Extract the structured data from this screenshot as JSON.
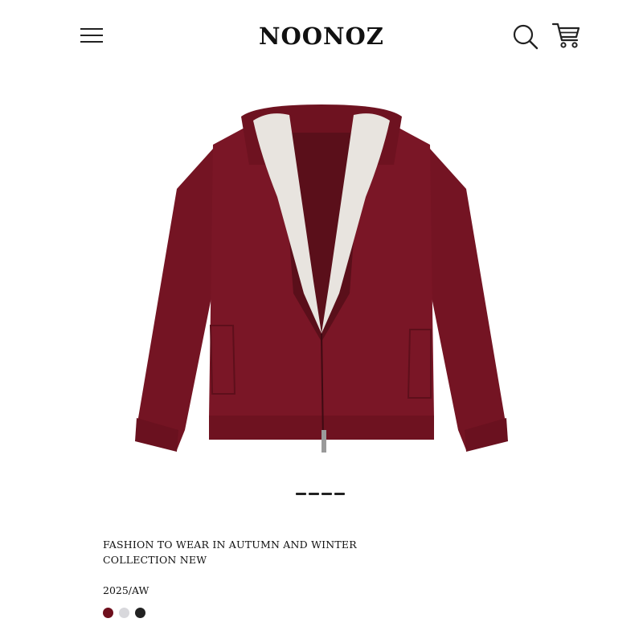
{
  "header": {
    "brand": "NOONOZ",
    "menu_icon": "hamburger-menu-icon",
    "search_icon": "search-icon",
    "cart_icon": "shopping-cart-icon"
  },
  "product": {
    "image": "burgundy knit zip-up hooded jacket with faux fur lining",
    "title_line1": "FASHION TO WEAR IN AUTUMN AND WINTER",
    "title_line2": "COLLECTION NEW",
    "season": "2025/AW",
    "colors": [
      "#6e0f1c",
      "#d8d8dc",
      "#222222"
    ]
  },
  "carousel": {
    "slide_count": 4,
    "active_index": 0
  },
  "theme": {
    "jacket_color": "#7a1626",
    "fur_color": "#e8e4df"
  }
}
